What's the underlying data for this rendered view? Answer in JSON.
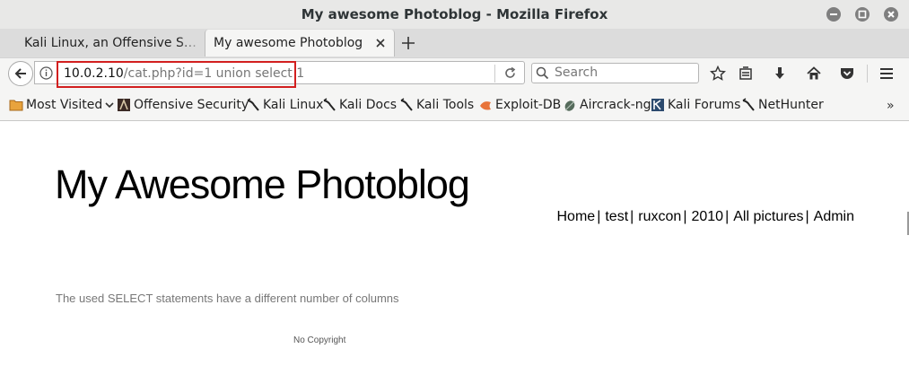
{
  "window": {
    "title": "My awesome Photoblog - Mozilla Firefox"
  },
  "tabs": [
    {
      "label": "Kali Linux, an Offensive S…",
      "active": false
    },
    {
      "label": "My awesome Photoblog",
      "active": true
    }
  ],
  "navbar": {
    "url_domain": "10.0.2.10",
    "url_path": "/cat.php?id=1 union select 1",
    "search_placeholder": "Search"
  },
  "bookmarks": [
    {
      "label": "Most Visited",
      "icon": "folder-icon",
      "has_dropdown": true
    },
    {
      "label": "Offensive Security",
      "icon": "offsec-icon"
    },
    {
      "label": "Kali Linux",
      "icon": "kali-dragon-icon"
    },
    {
      "label": "Kali Docs",
      "icon": "kali-dragon-icon"
    },
    {
      "label": "Kali Tools",
      "icon": "kali-dragon-icon"
    },
    {
      "label": "Exploit-DB",
      "icon": "exploitdb-icon"
    },
    {
      "label": "Aircrack-ng",
      "icon": "aircrack-icon"
    },
    {
      "label": "Kali Forums",
      "icon": "kali-forums-icon"
    },
    {
      "label": "NetHunter",
      "icon": "kali-dragon-icon"
    }
  ],
  "bookmarks_overflow": "»",
  "page": {
    "site_title": "My Awesome Photoblog",
    "nav": [
      "Home",
      "test",
      "ruxcon",
      "2010",
      "All pictures",
      "Admin"
    ],
    "nav_separator": "|",
    "error_message": "The used SELECT statements have a different number of columns",
    "footer": "No Copyright"
  },
  "colors": {
    "highlight_border": "#d21f1f",
    "titlebar_bg": "#e8e8e7",
    "toolbar_bg": "#f5f5f4"
  }
}
